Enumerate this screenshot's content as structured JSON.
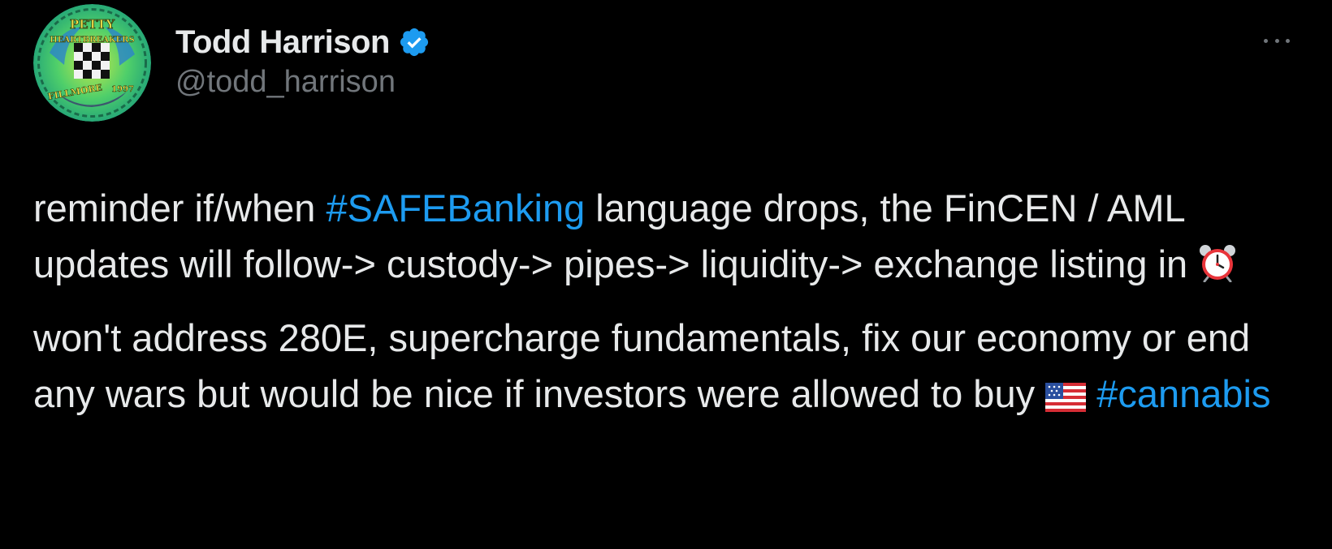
{
  "author": {
    "display_name": "Todd Harrison",
    "handle": "@todd_harrison",
    "verified": true,
    "avatar_text": {
      "top": "PETTY",
      "middle": "HEARTBREAKERS",
      "bottom": "FILLMORE",
      "year": "1997"
    }
  },
  "tweet": {
    "p1": {
      "a": "reminder if/when ",
      "hashtag": "#SAFEBanking",
      "b": " language drops, the FinCEN / AML updates will follow-> custody-> pipes-> liquidity-> exchange listing in ",
      "emoji": "alarm-clock-icon"
    },
    "p2": {
      "a": "won't address 280E, supercharge fundamentals, fix our economy or end any wars but would be nice if investors were allowed to buy ",
      "emoji": "us-flag-icon",
      "hashtag": "#cannabis"
    }
  },
  "colors": {
    "background": "#000000",
    "text": "#e7e9ea",
    "muted": "#71767b",
    "accent": "#1d9bf0"
  }
}
